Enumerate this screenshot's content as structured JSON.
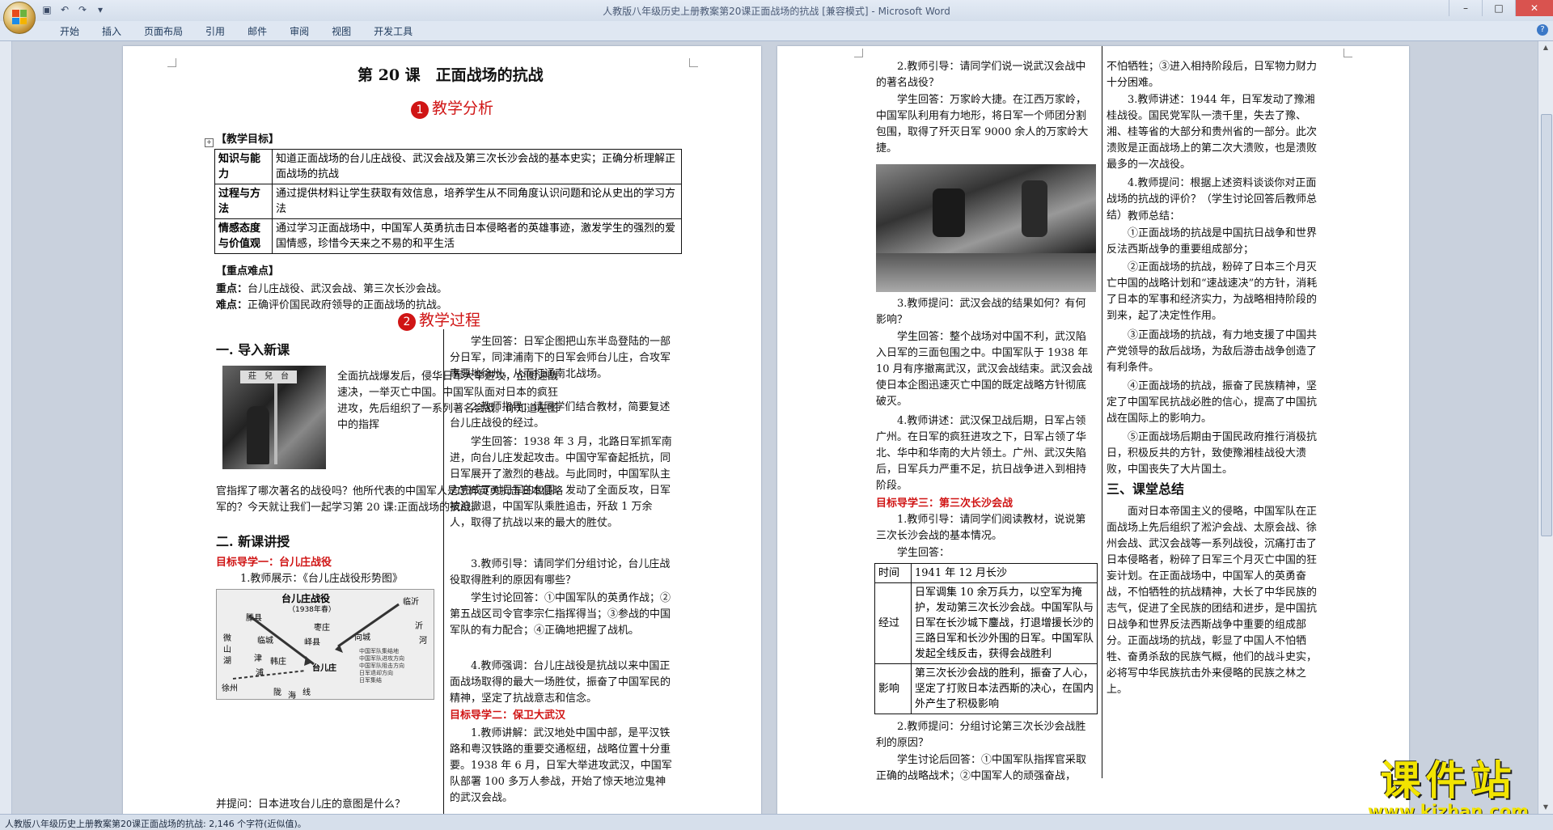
{
  "window": {
    "title": "人教版八年级历史上册教案第20课正面战场的抗战 [兼容模式] - Microsoft Word",
    "controls": [
      "–",
      "□",
      "✕"
    ]
  },
  "quick_access": [
    "save-icon",
    "undo-icon",
    "redo-icon",
    "customize-icon"
  ],
  "ribbon": {
    "tabs": [
      "开始",
      "插入",
      "页面布局",
      "引用",
      "邮件",
      "审阅",
      "视图",
      "开发工具"
    ]
  },
  "status": {
    "text": "人教版八年级历史上册教案第20课正面战场的抗战: 2,146 个字符(近似值)。"
  },
  "watermark": {
    "brand": "课件站",
    "url": "www.kjzhan.com"
  },
  "page1": {
    "title": "第 20 课　正面战场的抗战",
    "sec1_num": "1",
    "sec1": "教学分析",
    "goals_head": "【教学目标】",
    "goals": [
      {
        "head": "知识与能力",
        "text": "知道正面战场的台儿庄战役、武汉会战及第三次长沙会战的基本史实；正确分析理解正面战场的抗战"
      },
      {
        "head": "过程与方法",
        "text": "通过提供材料让学生获取有效信息，培养学生从不同角度认识问题和论从史出的学习方法"
      },
      {
        "head": "情感态度与价值观",
        "text": "通过学习正面战场中，中国军人英勇抗击日本侵略者的英雄事迹，激发学生的强烈的爱国情感，珍惜今天来之不易的和平生活"
      }
    ],
    "key_head": "【重点难点】",
    "key_label": "重点：",
    "key_text": "台儿庄战役、武汉会战、第三次长沙会战。",
    "diff_label": "难点：",
    "diff_text": "正确评价国民政府领导的正面战场的抗战。",
    "sec2_num": "2",
    "sec2": "教学过程",
    "intro_head": "一. 导入新课",
    "intro_text_a": "全面抗战爆发后，侵华日军大举进攻，企图速战速决，一举灭亡中国。中国军队面对日本的疯狂进攻，先后组织了一系列著名会战。你知道左图中的指挥",
    "intro_text_b": "官指挥了哪次著名的战役吗？他所代表的中国军人是怎样英勇抗击日本侵略军的？今天就让我们一起学习第 20 课:正面战场的抗战。",
    "photo_sign": "莊　兒　台",
    "new_head": "二. 新课讲授",
    "goal1": "目标导学一：台儿庄战役",
    "step1": "1.教师展示：《台儿庄战役形势图》",
    "map_title": "台儿庄战役",
    "map_year": "（1938年春）",
    "map_places": [
      "临沂",
      "滕县",
      "枣庄",
      "峄县",
      "向城",
      "临城",
      "韩庄",
      "台儿庄",
      "微山湖",
      "徐州",
      "沂",
      "河",
      "陇",
      "海",
      "线",
      "津",
      "浦"
    ],
    "map_legend": [
      "中国军队集结地",
      "中国军队进攻方向",
      "中国军队阻击方向",
      "日军退却方向",
      "日军集结"
    ],
    "ask_tail": "并提问：日本进攻台儿庄的意图是什么？",
    "col2": [
      "学生回答：日军企图把山东半岛登陆的一部分日军，同津浦南下的日军会师台儿庄，合攻军事要地徐州，从而打通南北战场。",
      "2.教师指导：请同学们结合教材，简要复述台儿庄战役的经过。",
      "学生回答：1938 年 3 月，北路日军抓军南进，向台儿庄发起攻击。中国守军奋起抵抗，同日军展开了激烈的巷战。与此同时，中国军队主力完成了对日军的包围，发动了全面反攻，日军被迫撤退，中国军队乘胜追击，歼敌 1 万余人，取得了抗战以来的最大的胜仗。",
      "3.教师引导：请同学们分组讨论，台儿庄战役取得胜利的原因有哪些？",
      "学生讨论回答：①中国军队的英勇作战；②第五战区司令官李宗仁指挥得当；③参战的中国军队的有力配合；④正确地把握了战机。",
      "4.教师强调：台儿庄战役是抗战以来中国正面战场取得的最大一场胜仗，振奋了中国军民的精神，坚定了抗战意志和信念。"
    ],
    "goal2": "目标导学二：保卫大武汉",
    "col2_b": "1.教师讲解：武汉地处中国中部，是平汉铁路和粤汉铁路的重要交通枢纽，战略位置十分重要。1938 年 6 月，日军大举进攻武汉，中国军队部署 100 多万人参战，开始了惊天地泣鬼神的武汉会战。"
  },
  "page2": {
    "colA": [
      "2.教师引导：请同学们说一说武汉会战中的著名战役？",
      "学生回答：万家岭大捷。在江西万家岭，中国军队利用有力地形，将日军一个师团分割包围，取得了歼灭日军 9000 余人的万家岭大捷。"
    ],
    "colA_b": [
      "3.教师提问：武汉会战的结果如何？有何影响？",
      "学生回答：整个战场对中国不利，武汉陷入日军的三面包围之中。中国军队于 1938 年 10 月有序撤离武汉，武汉会战结束。武汉会战使日本企图迅速灭亡中国的既定战略方针彻底破灭。",
      "4.教师讲述：武汉保卫战后期，日军占领广州。在日军的疯狂进攻之下，日军占领了华北、华中和华南的大片领土。广州、武汉失陷后，日军兵力严重不足，抗日战争进入到相持阶段。"
    ],
    "goal3": "目标导学三：第三次长沙会战",
    "colA_c": [
      "1.教师引导：请同学们阅读教材，说说第三次长沙会战的基本情况。",
      "学生回答："
    ],
    "table": [
      {
        "head": "时间",
        "text": "1941 年 12 月长沙"
      },
      {
        "head": "经过",
        "text": "日军调集 10 余万兵力，以空军为掩护，发动第三次长沙会战。中国军队与日军在长沙城下鏖战，打退增援长沙的三路日军和长沙外围的日军。中国军队发起全线反击，获得会战胜利"
      },
      {
        "head": "影响",
        "text": "第三次长沙会战的胜利，振奋了人心，坚定了打败日本法西斯的决心，在国内外产生了积极影响"
      }
    ],
    "colA_d": [
      "2.教师提问：分组讨论第三次长沙会战胜利的原因？",
      "学生讨论后回答：①中国军队指挥官采取正确的战略战术；②中国军人的顽强奋战，"
    ],
    "colB": [
      "不怕牺牲；③进入相持阶段后，日军物力财力十分困难。",
      "3.教师讲述：1944 年，日军发动了豫湘桂战役。国民党军队一溃千里，失去了豫、湘、桂等省的大部分和贵州省的一部分。此次溃败是正面战场上的第二次大溃败，也是溃败最多的一次战役。",
      "4.教师提问：根据上述资料谈谈你对正面战场的抗战的评价？（学生讨论回答后教师总结）",
      "教师总结：",
      "①正面战场的抗战是中国抗日战争和世界反法西斯战争的重要组成部分；",
      "②正面战场的抗战，粉碎了日本三个月灭亡中国的战略计划和“速战速决”的方针，消耗了日本的军事和经济实力，为战略相持阶段的到来，起了决定性作用。",
      "③正面战场的抗战，有力地支援了中国共产党领导的敌后战场，为敌后游击战争创造了有利条件。",
      "④正面战场的抗战，振奋了民族精神，坚定了中国军民抗战必胜的信心，提高了中国抗战在国际上的影响力。",
      "⑤正面战场后期由于国民政府推行消极抗日，积极反共的方针，致使豫湘桂战役大溃败，中国丧失了大片国土。"
    ],
    "summary_head": "三、课堂总结",
    "summary": "面对日本帝国主义的侵略，中国军队在正面战场上先后组织了淞沪会战、太原会战、徐州会战、武汉会战等一系列战役，沉痛打击了日本侵略者，粉碎了日军三个月灭亡中国的狂妄计划。在正面战场中，中国军人的英勇奋战，不怕牺牲的抗战精神，大长了中华民族的志气，促进了全民族的团结和进步，是中国抗日战争和世界反法西斯战争中重要的组成部分。正面战场的抗战，彰显了中国人不怕牺牲、奋勇杀敌的民族气概，他们的战斗史实，必将写中华民族抗击外来侵略的民族之林之上。"
  }
}
